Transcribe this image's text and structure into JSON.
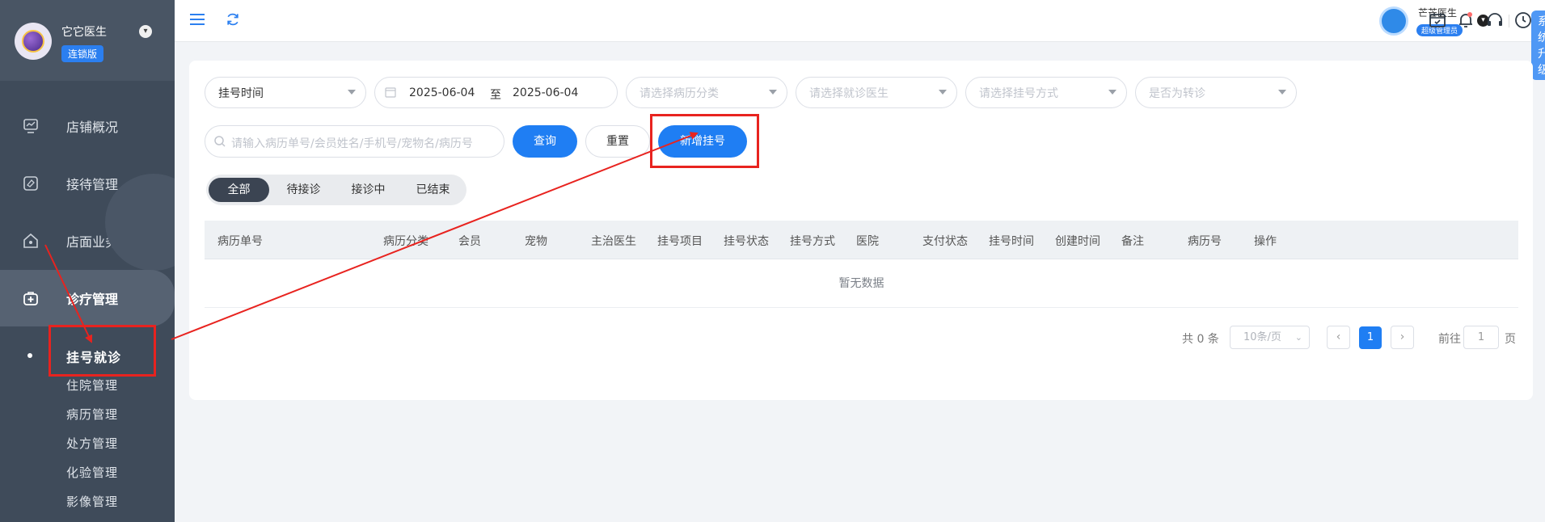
{
  "sidebar": {
    "user_name": "它它医生",
    "user_badge": "连锁版",
    "items": [
      {
        "label": "店铺概况",
        "icon": "dashboard-icon"
      },
      {
        "label": "接待管理",
        "icon": "reception-icon"
      },
      {
        "label": "店面业务",
        "icon": "store-icon"
      },
      {
        "label": "诊疗管理",
        "icon": "medical-kit-icon"
      }
    ],
    "subitems": [
      "挂号就诊",
      "住院管理",
      "病历管理",
      "处方管理",
      "化验管理",
      "影像管理"
    ]
  },
  "header": {
    "user_name": "芒芒医生",
    "user_role": "超级管理员",
    "upgrade_label": "系统升级"
  },
  "filters": {
    "time_type": "挂号时间",
    "date_start": "2025-06-04",
    "date_sep": "至",
    "date_end": "2025-06-04",
    "record_category_placeholder": "请选择病历分类",
    "doctor_placeholder": "请选择就诊医生",
    "reg_method_placeholder": "请选择挂号方式",
    "transfer_placeholder": "是否为转诊",
    "search_placeholder": "请输入病历单号/会员姓名/手机号/宠物名/病历号"
  },
  "buttons": {
    "query": "查询",
    "reset": "重置",
    "add": "新增挂号"
  },
  "tabs": [
    "全部",
    "待接诊",
    "接诊中",
    "已结束"
  ],
  "table": {
    "columns": [
      "病历单号",
      "病历分类",
      "会员",
      "宠物",
      "主治医生",
      "挂号项目",
      "挂号状态",
      "挂号方式",
      "医院",
      "支付状态",
      "挂号时间",
      "创建时间",
      "备注",
      "病历号",
      "操作"
    ],
    "empty_text": "暂无数据"
  },
  "pagination": {
    "total": "共 0 条",
    "page_size": "10条/页",
    "current_page": "1",
    "goto_label": "前往",
    "goto_value": "1",
    "page_suffix": "页"
  },
  "colors": {
    "primary": "#1f7ef3",
    "sidebar": "#3f4b5a",
    "annotation_red": "#e8231f"
  }
}
